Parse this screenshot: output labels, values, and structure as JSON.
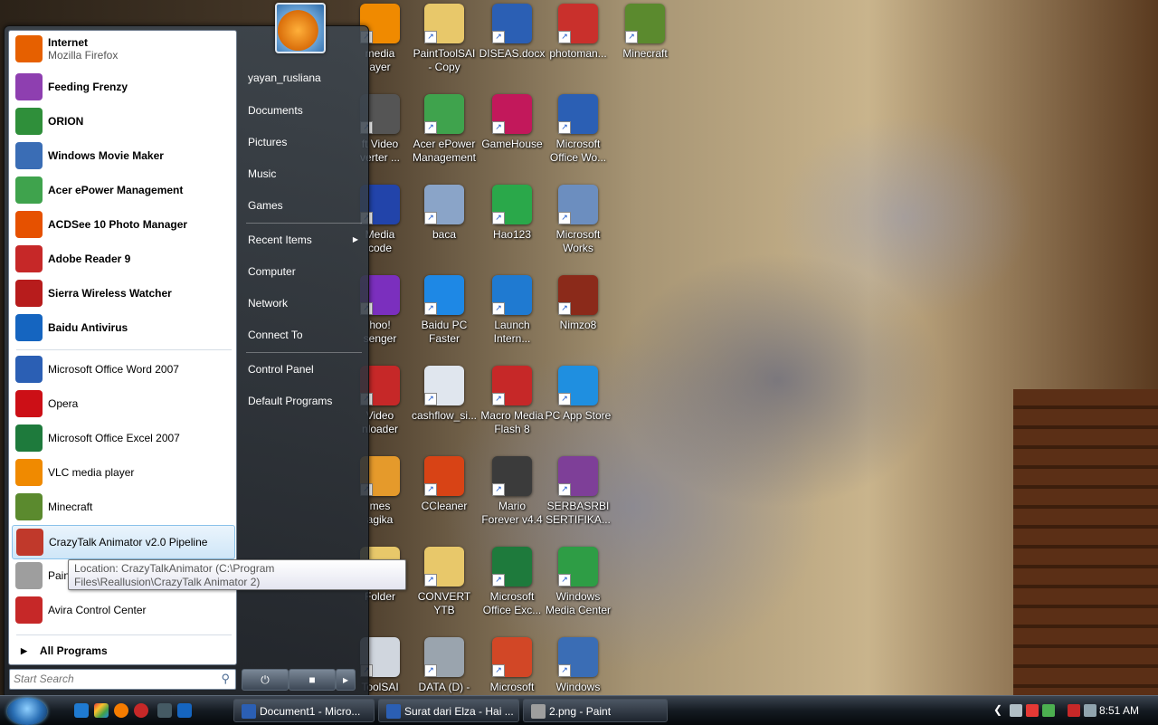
{
  "desktop_icons": [
    {
      "label": "media\nayer",
      "icon": "vlc-icon",
      "color": "#f08a00"
    },
    {
      "label": "PaintToolSAI\n- Copy",
      "icon": "folder-icon",
      "color": "#e8c86a"
    },
    {
      "label": "DISEAS.docx",
      "icon": "word-doc-icon",
      "color": "#2b5fb4"
    },
    {
      "label": "photoman...",
      "icon": "photoman-icon",
      "color": "#c9302c"
    },
    {
      "label": "Minecraft",
      "icon": "minecraft-icon",
      "color": "#5b8a2e"
    },
    {
      "label": "ft Video\nverter ...",
      "icon": "video-converter-icon",
      "color": "#555"
    },
    {
      "label": "Acer ePower\nManagement",
      "icon": "battery-icon",
      "color": "#3fa34d"
    },
    {
      "label": "GameHouse",
      "icon": "gamehouse-icon",
      "color": "#c2185b"
    },
    {
      "label": "Microsoft\nOffice Wo...",
      "icon": "word-icon",
      "color": "#2b5fb4"
    },
    {
      "label": "Media\ncode",
      "icon": "film-icon",
      "color": "#2244aa"
    },
    {
      "label": "baca",
      "icon": "cd-icon",
      "color": "#8aa4c8"
    },
    {
      "label": "Hao123",
      "icon": "hao123-icon",
      "color": "#2aa84a"
    },
    {
      "label": "Microsoft\nWorks",
      "icon": "works-icon",
      "color": "#6c8ebf"
    },
    {
      "label": "hoo!\nsenger",
      "icon": "yahoo-icon",
      "color": "#7b2fbe"
    },
    {
      "label": "Baidu PC\nFaster",
      "icon": "baidu-faster-icon",
      "color": "#1e88e5"
    },
    {
      "label": "Launch\nIntern...",
      "icon": "ie-icon",
      "color": "#1f7ad1"
    },
    {
      "label": "Nimzo8",
      "icon": "chess-icon",
      "color": "#8b2a1a"
    },
    {
      "label": "Video\nnloader",
      "icon": "downloader-icon",
      "color": "#c62828"
    },
    {
      "label": "cashflow_si...",
      "icon": "spreadsheet-file-icon",
      "color": "#e0e6ee"
    },
    {
      "label": "Macro Media\nFlash 8",
      "icon": "flash-icon",
      "color": "#c62828"
    },
    {
      "label": "PC App Store",
      "icon": "app-store-icon",
      "color": "#1f8fe0"
    },
    {
      "label": "mes\nagika",
      "icon": "game-icon",
      "color": "#e59a2b"
    },
    {
      "label": "CCleaner",
      "icon": "ccleaner-icon",
      "color": "#d84315"
    },
    {
      "label": "Mario\nForever v4.4",
      "icon": "mario-icon",
      "color": "#3b3b3b"
    },
    {
      "label": "SERBASRBI\nSERTIFIKA...",
      "icon": "winrar-icon",
      "color": "#7e3f98"
    },
    {
      "label": "Folder",
      "icon": "folder-icon",
      "color": "#e8c86a"
    },
    {
      "label": "CONVERT\nYTB",
      "icon": "folder-icon",
      "color": "#e8c86a"
    },
    {
      "label": "Microsoft\nOffice Exc...",
      "icon": "excel-icon",
      "color": "#1e7a3c"
    },
    {
      "label": "Windows\nMedia Center",
      "icon": "media-center-icon",
      "color": "#2e9d45"
    },
    {
      "label": "ToolSAI",
      "icon": "sai-icon",
      "color": "#d0d6de"
    },
    {
      "label": "DATA (D) -",
      "icon": "drive-icon",
      "color": "#9aa4ae"
    },
    {
      "label": "Microsoft",
      "icon": "powerpoint-icon",
      "color": "#d24726"
    },
    {
      "label": "Windows",
      "icon": "movie-maker-icon",
      "color": "#3a6db5"
    }
  ],
  "start_menu": {
    "pinned": [
      {
        "title": "Internet",
        "subtitle": "Mozilla Firefox",
        "icon": "firefox-icon",
        "color": "#e66000"
      },
      {
        "title": "Feeding Frenzy",
        "icon": "fish-icon",
        "color": "#8e3fb0"
      },
      {
        "title": "ORION",
        "icon": "orion-icon",
        "color": "#2f8f3a"
      },
      {
        "title": "Windows Movie Maker",
        "icon": "movie-maker-icon",
        "color": "#3a6db5"
      },
      {
        "title": "Acer ePower Management",
        "icon": "battery-icon",
        "color": "#3fa34d"
      },
      {
        "title": "ACDSee 10 Photo Manager",
        "icon": "acdsee-icon",
        "color": "#e65100"
      },
      {
        "title": "Adobe Reader 9",
        "icon": "pdf-icon",
        "color": "#c62828"
      },
      {
        "title": "Sierra Wireless Watcher",
        "icon": "sierra-icon",
        "color": "#b71c1c"
      },
      {
        "title": "Baidu Antivirus",
        "icon": "shield-icon",
        "color": "#1565c0"
      }
    ],
    "recent": [
      {
        "title": "Microsoft Office Word 2007",
        "icon": "word-icon",
        "color": "#2b5fb4"
      },
      {
        "title": "Opera",
        "icon": "opera-icon",
        "color": "#cc0f16"
      },
      {
        "title": "Microsoft Office Excel 2007",
        "icon": "excel-icon",
        "color": "#1e7a3c"
      },
      {
        "title": "VLC media player",
        "icon": "vlc-icon",
        "color": "#f08a00"
      },
      {
        "title": "Minecraft",
        "icon": "minecraft-icon",
        "color": "#5b8a2e"
      },
      {
        "title": "CrazyTalk Animator v2.0 Pipeline",
        "icon": "crazytalk-icon",
        "color": "#c0392b"
      },
      {
        "title": "Paint",
        "icon": "paint-icon",
        "color": "#9e9e9e"
      },
      {
        "title": "Avira Control Center",
        "icon": "avira-icon",
        "color": "#c62828"
      }
    ],
    "all_programs": "All Programs",
    "search_placeholder": "Start Search",
    "tooltip": "Location: CrazyTalkAnimator (C:\\Program Files\\Reallusion\\CrazyTalk Animator 2)",
    "right_items": [
      {
        "label": "yayan_rusliana"
      },
      {
        "label": "Documents"
      },
      {
        "label": "Pictures"
      },
      {
        "label": "Music"
      },
      {
        "label": "Games"
      },
      {
        "label": "Recent Items",
        "submenu": true
      },
      {
        "label": "Computer"
      },
      {
        "label": "Network"
      },
      {
        "label": "Connect To"
      },
      {
        "label": "Control Panel"
      },
      {
        "label": "Default Programs"
      }
    ]
  },
  "taskbar": {
    "buttons": [
      {
        "label": "Document1 - Micro...",
        "icon": "word-icon",
        "color": "#2b5fb4"
      },
      {
        "label": "Surat dari Elza - Hai ...",
        "icon": "word-icon",
        "color": "#2b5fb4"
      },
      {
        "label": "2.png - Paint",
        "icon": "paint-icon",
        "color": "#9e9e9e"
      }
    ],
    "clock": "8:51 AM"
  }
}
